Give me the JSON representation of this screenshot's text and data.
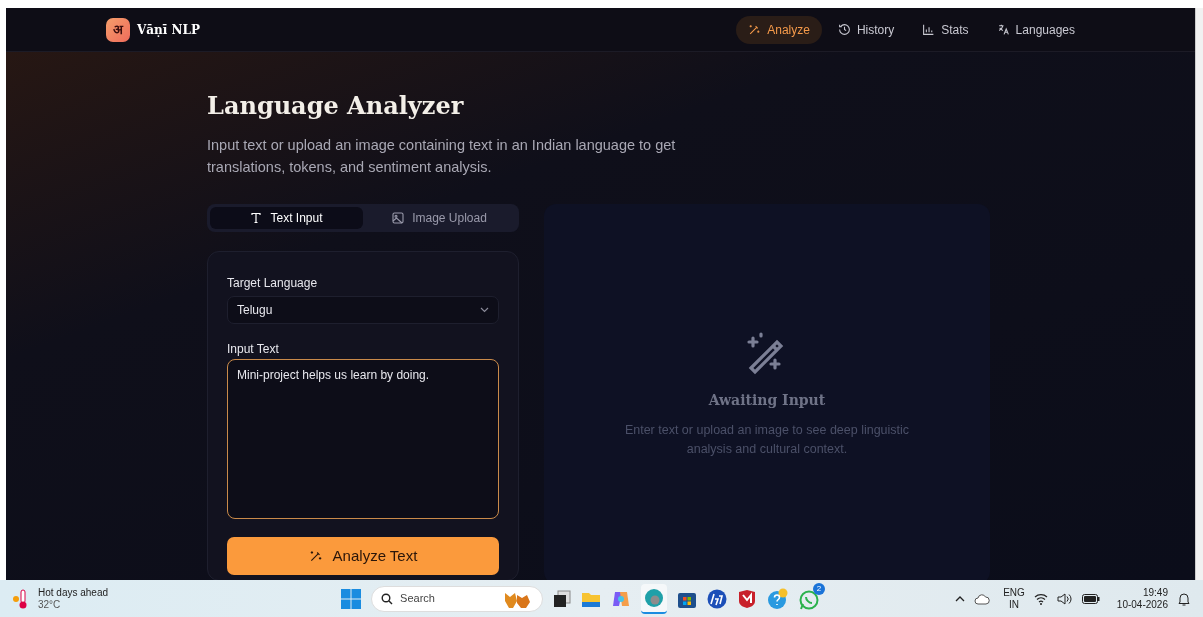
{
  "app": {
    "logo_glyph": "अ",
    "brand": "Vāṇī NLP"
  },
  "nav": [
    {
      "label": "Analyze",
      "selected": true
    },
    {
      "label": "History",
      "selected": false
    },
    {
      "label": "Stats",
      "selected": false
    },
    {
      "label": "Languages",
      "selected": false
    }
  ],
  "heading": "Language Analyzer",
  "description": "Input text or upload an image containing text in an Indian language to get translations, tokens, and sentiment analysis.",
  "mode_tabs": [
    {
      "label": "Text Input",
      "selected": true
    },
    {
      "label": "Image Upload",
      "selected": false
    }
  ],
  "form": {
    "target_language_label": "Target Language",
    "target_language": "Telugu",
    "input_label": "Input Text",
    "input_value": "Mini-project helps us learn by doing.",
    "submit": "Analyze Text"
  },
  "result_panel": {
    "title": "Awaiting Input",
    "message": "Enter text or upload an image to see deep linguistic analysis and cultural context."
  },
  "taskbar": {
    "weather_title": "Hot days ahead",
    "temperature": "32°C",
    "search_label": "Search",
    "whatsapp_badge": "2",
    "language": "ENG",
    "region": "IN",
    "time": "19:49",
    "date": "10-04-2026"
  }
}
